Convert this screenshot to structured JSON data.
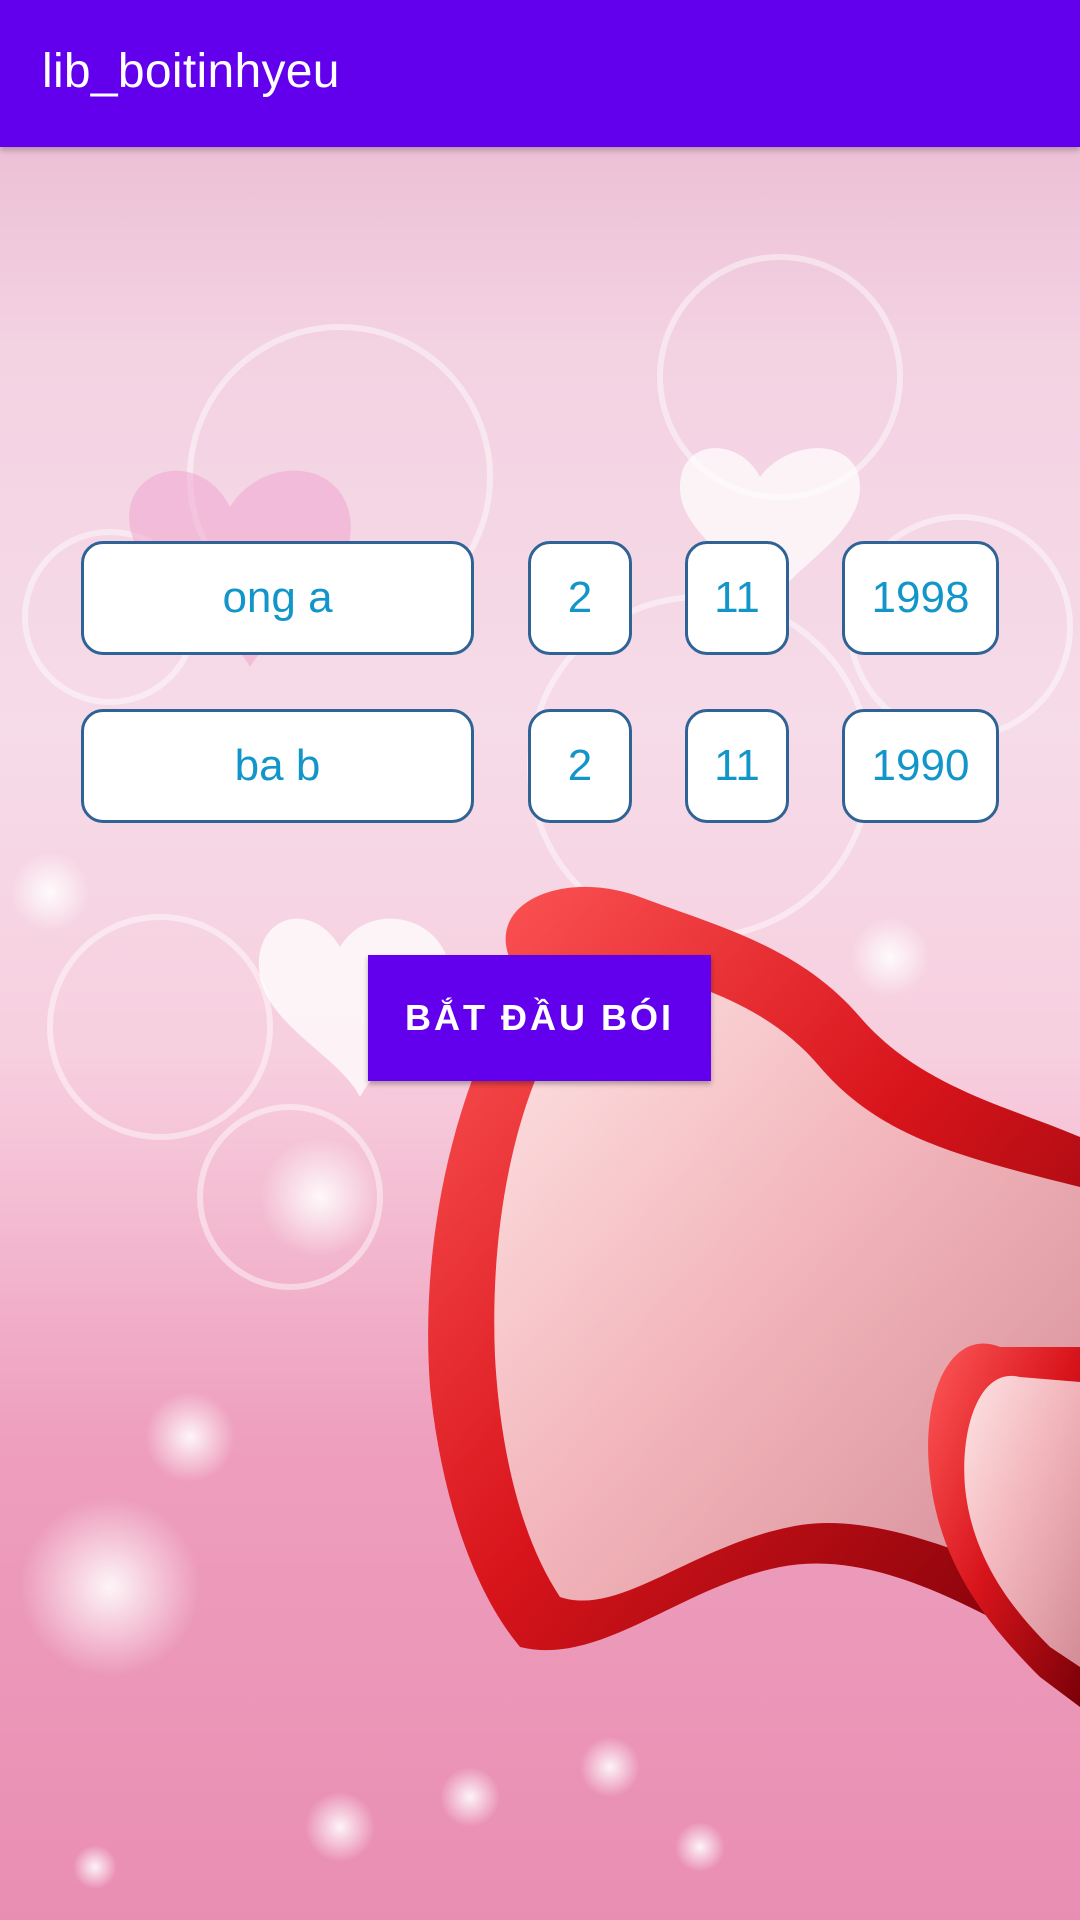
{
  "app_bar": {
    "title": "lib_boitinhyeu",
    "background_color": "#6200ee"
  },
  "background": {
    "description_icon": "heart-illustration"
  },
  "person1": {
    "name": "ong a",
    "day": "2",
    "month": "11",
    "year": "1998"
  },
  "person2": {
    "name": "ba b",
    "day": "2",
    "month": "11",
    "year": "1990"
  },
  "start_button": {
    "label": "BẮT ĐẦU BÓI"
  },
  "colors": {
    "accent": "#6200ee",
    "field_text": "#1296c9",
    "field_border": "#2f6396"
  }
}
